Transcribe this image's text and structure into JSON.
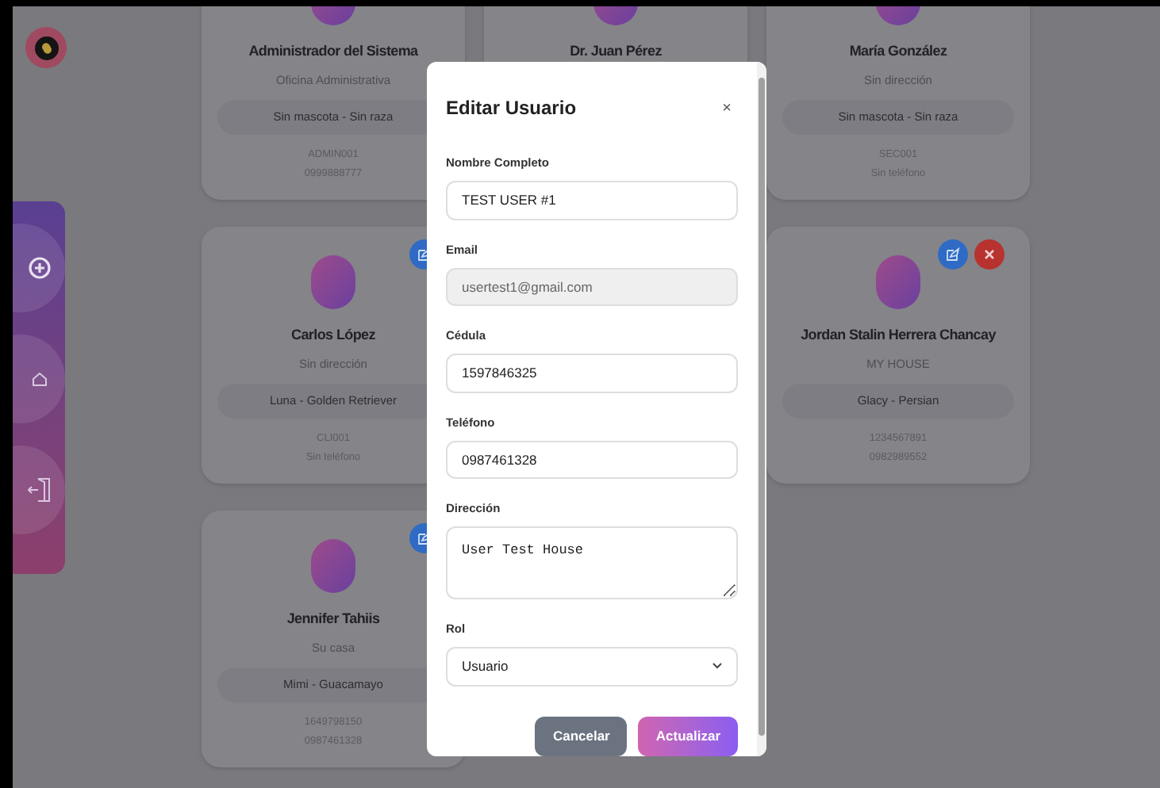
{
  "sidebar": {
    "nav_items": [
      {
        "kind": "add"
      },
      {
        "kind": "home"
      },
      {
        "kind": "logout"
      }
    ]
  },
  "columns": [
    {
      "cards": [
        {
          "name": "Administrador del Sistema",
          "address": "Oficina Administrativa",
          "pet": "Sin mascota - Sin raza",
          "code": "ADMIN001",
          "phone": "0999888777"
        },
        {
          "name": "Carlos López",
          "address": "Sin dirección",
          "pet": "Luna - Golden Retriever",
          "code": "CLI001",
          "phone": "Sin teléfono",
          "actions": [
            {
              "kind": "edit"
            }
          ]
        },
        {
          "name": "Jennifer Tahiis",
          "address": "Su casa",
          "pet": "Mimi - Guacamayo",
          "code": "1649798150",
          "phone": "0987461328",
          "actions": [
            {
              "kind": "edit"
            }
          ]
        }
      ]
    },
    {
      "cards": [
        {
          "name": "Dr. Juan Pérez"
        }
      ]
    },
    {
      "cards": [
        {
          "name": "María González",
          "address": "Sin dirección",
          "pet": "Sin mascota - Sin raza",
          "code": "SEC001",
          "phone": "Sin teléfono"
        },
        {
          "name": "Jordan Stalin Herrera Chancay",
          "address": "MY HOUSE",
          "pet": "Glacy - Persian",
          "code": "1234567891",
          "phone": "0982989552",
          "actions": [
            {
              "kind": "edit"
            },
            {
              "kind": "delete"
            }
          ]
        }
      ]
    }
  ],
  "modal": {
    "title": "Editar Usuario",
    "close": "×",
    "fields": [
      {
        "label": "Nombre Completo",
        "value": "TEST USER #1",
        "kind": "text"
      },
      {
        "label": "Email",
        "value": "usertest1@gmail.com",
        "kind": "readonly"
      },
      {
        "label": "Cédula",
        "value": "1597846325",
        "kind": "text"
      },
      {
        "label": "Teléfono",
        "value": "0987461328",
        "kind": "text"
      },
      {
        "label": "Dirección",
        "value": "User Test House",
        "kind": "textarea"
      },
      {
        "label": "Rol",
        "value": "Usuario",
        "kind": "select"
      }
    ],
    "buttons": [
      {
        "label": "Cancelar",
        "kind": "secondary"
      },
      {
        "label": "Actualizar",
        "kind": "primary"
      }
    ]
  }
}
